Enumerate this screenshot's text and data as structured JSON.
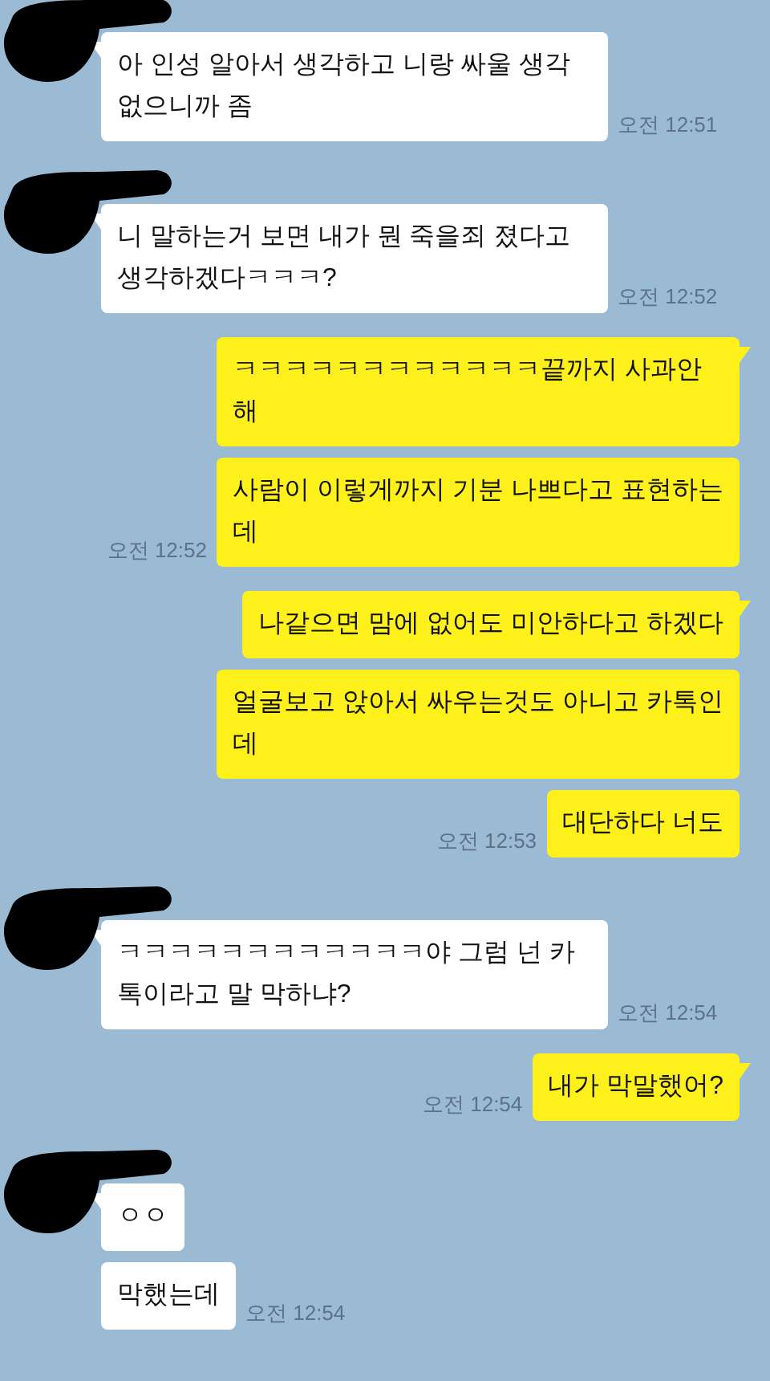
{
  "messages_groups": [
    {
      "kind": "them",
      "messages": [
        "아 인성 알아서 생각하고 니랑 싸울 생각 없으니까 좀"
      ],
      "time": "오전 12:51"
    },
    {
      "kind": "them",
      "messages": [
        "니 말하는거 보면 내가 뭔 죽을죄 졌다고 생각하겠다ㅋㅋㅋ?"
      ],
      "time": "오전 12:52"
    },
    {
      "kind": "me",
      "messages": [
        "ㅋㅋㅋㅋㅋㅋㅋㅋㅋㅋㅋㅋ끝까지 사과안해",
        "사람이 이렇게까지 기분 나쁘다고 표현하는데"
      ],
      "time": "오전 12:52"
    },
    {
      "kind": "me",
      "messages": [
        "나같으면 맘에 없어도 미안하다고 하겠다",
        "얼굴보고 앉아서 싸우는것도 아니고 카톡인데",
        "대단하다 너도"
      ],
      "time": "오전 12:53"
    },
    {
      "kind": "them",
      "messages": [
        "ㅋㅋㅋㅋㅋㅋㅋㅋㅋㅋㅋㅋ야 그럼 넌 카톡이라고 말 막하냐?"
      ],
      "time": "오전 12:54"
    },
    {
      "kind": "me",
      "messages": [
        "내가 막말했어?"
      ],
      "time": "오전 12:54"
    },
    {
      "kind": "them",
      "messages": [
        "ㅇㅇ",
        "막했는데"
      ],
      "time": "오전 12:54"
    }
  ]
}
